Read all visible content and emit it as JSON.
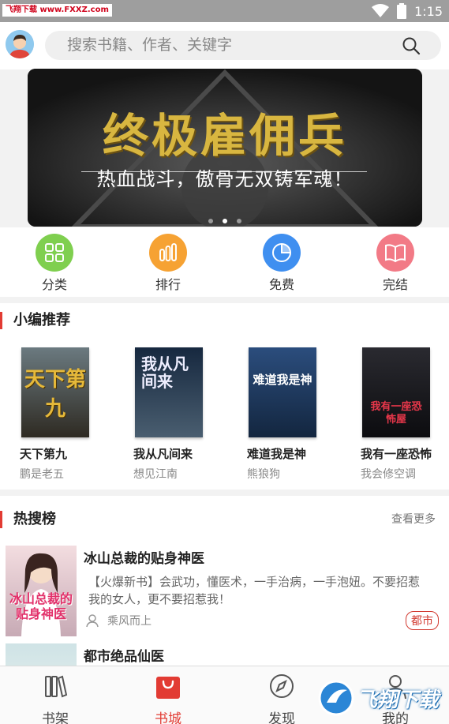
{
  "status_bar": {
    "watermark": "飞翔下载 www.FXXZ.com",
    "time": "1:15"
  },
  "search": {
    "placeholder": "搜索书籍、作者、关键字"
  },
  "banner": {
    "headline": "终极雇佣兵",
    "tagline": "热血战斗，傲骨无双铸军魂！",
    "dots": 3,
    "active_dot": 1
  },
  "categories": [
    {
      "label": "分类",
      "icon": "grid-icon",
      "color": "#7fcf4f"
    },
    {
      "label": "排行",
      "icon": "bars-icon",
      "color": "#f6a233"
    },
    {
      "label": "免费",
      "icon": "pie-icon",
      "color": "#3f8ff0"
    },
    {
      "label": "完结",
      "icon": "book-open-icon",
      "color": "#f27a86"
    }
  ],
  "editor_picks": {
    "title": "小编推荐",
    "books": [
      {
        "title": "天下第九",
        "author": "鹏是老五",
        "cover_text": "天下第九"
      },
      {
        "title": "我从凡间来",
        "author": "想见江南",
        "cover_text": "我从凡间来"
      },
      {
        "title": "难道我是神",
        "author": "熊狼狗",
        "cover_text": "难道我是神"
      },
      {
        "title": "我有一座恐怖",
        "author": "我会修空调",
        "cover_text": "我有一座恐怖屋"
      }
    ]
  },
  "hot": {
    "title": "热搜榜",
    "more": "查看更多",
    "items": [
      {
        "title": "冰山总裁的贴身神医",
        "desc": "【火爆新书】会武功，懂医术，一手治病，一手泡妞。不要招惹我的女人，更不要招惹我！",
        "author": "乘风而上",
        "tag": "都市",
        "cover_text": "冰山总裁的贴身神医"
      },
      {
        "title": "都市绝品仙医",
        "desc": "",
        "author": "",
        "tag": ""
      }
    ]
  },
  "bottom_nav": [
    {
      "label": "书架",
      "icon": "bookshelf-icon",
      "active": false
    },
    {
      "label": "书城",
      "icon": "shopping-bag-icon",
      "active": true
    },
    {
      "label": "发现",
      "icon": "compass-icon",
      "active": false
    },
    {
      "label": "我的",
      "icon": "user-icon",
      "active": false
    }
  ],
  "footer_watermark": "飞翔下载",
  "colors": {
    "accent": "#e23b33",
    "status_bar": "#9e9e9e"
  }
}
